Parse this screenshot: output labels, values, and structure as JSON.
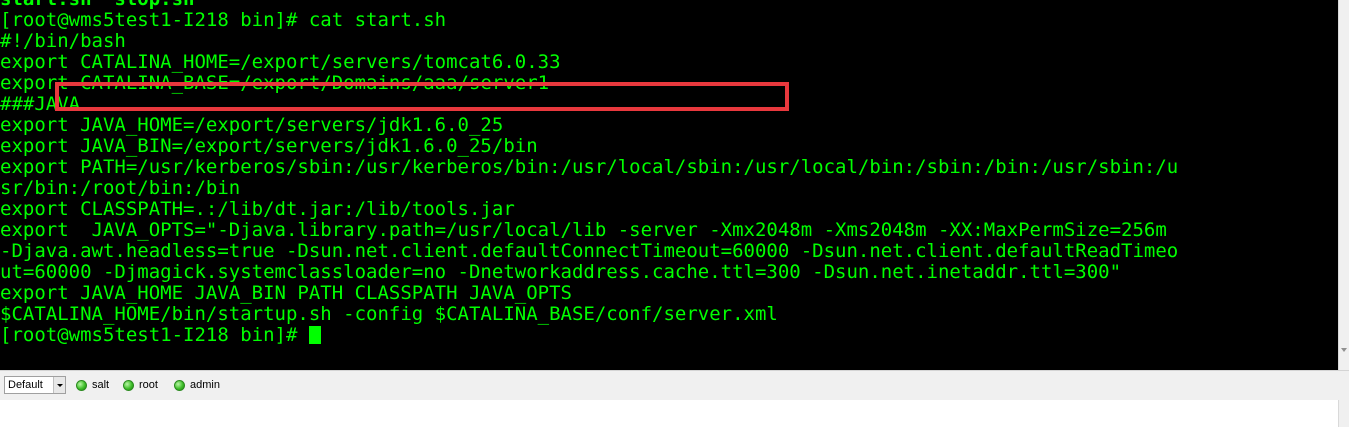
{
  "terminal": {
    "lines": [
      "start.sh  stop.sh",
      "[root@wms5test1-I218 bin]# cat start.sh",
      "#!/bin/bash",
      "export CATALINA_HOME=/export/servers/tomcat6.0.33",
      "export CATALINA_BASE=/export/Domains/aaa/server1",
      "###JAVA",
      "export JAVA_HOME=/export/servers/jdk1.6.0_25",
      "export JAVA_BIN=/export/servers/jdk1.6.0_25/bin",
      "export PATH=/usr/kerberos/sbin:/usr/kerberos/bin:/usr/local/sbin:/usr/local/bin:/sbin:/bin:/usr/sbin:/u",
      "sr/bin:/root/bin:/bin",
      "export CLASSPATH=.:/lib/dt.jar:/lib/tools.jar",
      "export  JAVA_OPTS=\"-Djava.library.path=/usr/local/lib -server -Xmx2048m -Xms2048m -XX:MaxPermSize=256m",
      "-Djava.awt.headless=true -Dsun.net.client.defaultConnectTimeout=60000 -Dsun.net.client.defaultReadTimeo",
      "ut=60000 -Djmagick.systemclassloader=no -Dnetworkaddress.cache.ttl=300 -Dsun.net.inetaddr.ttl=300\"",
      "export JAVA_HOME JAVA_BIN PATH CLASSPATH JAVA_OPTS",
      "$CATALINA_HOME/bin/startup.sh -config $CATALINA_BASE/conf/server.xml",
      "[root@wms5test1-I218 bin]# "
    ],
    "text_color": "#00ff00",
    "background": "#000000",
    "highlight_color": "#e8383d"
  },
  "statusbar": {
    "profile_select": "Default",
    "sessions": [
      {
        "label": "salt",
        "icon": "green-status-dot-icon"
      },
      {
        "label": "root",
        "icon": "green-status-dot-icon"
      },
      {
        "label": "admin",
        "icon": "green-status-dot-icon"
      }
    ]
  }
}
